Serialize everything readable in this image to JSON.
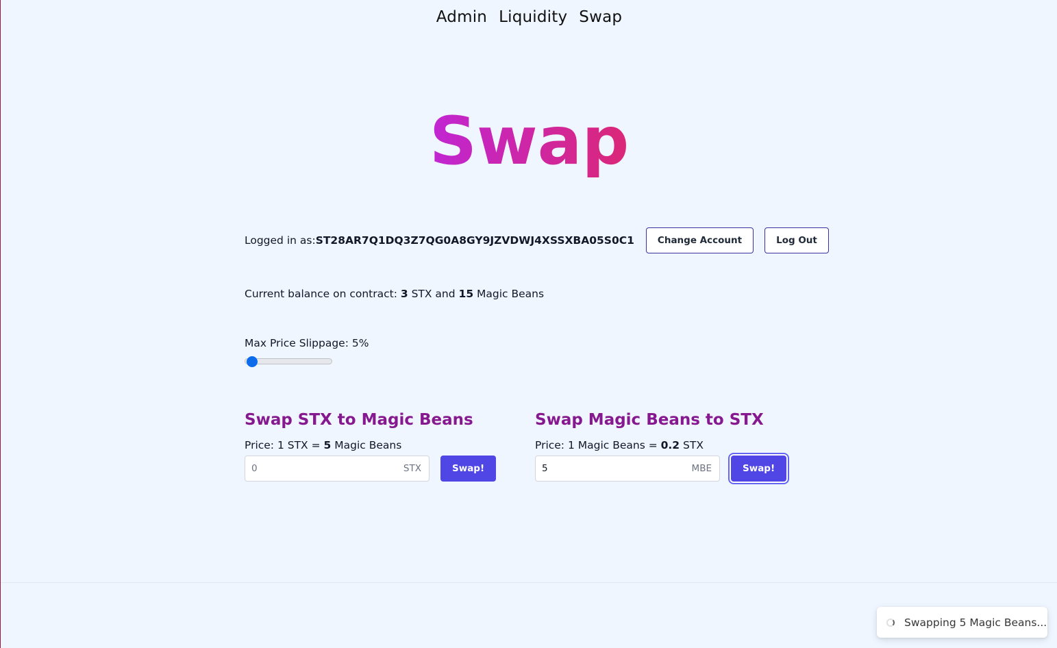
{
  "nav": {
    "items": [
      {
        "label": "Admin"
      },
      {
        "label": "Liquidity"
      },
      {
        "label": "Swap"
      }
    ]
  },
  "hero": {
    "title": "Swap"
  },
  "account": {
    "logged_in_label": "Logged in as: ",
    "address": "ST28AR7Q1DQ3Z7QG0A8GY9JZVDWJ4XSSXBA05S0C1",
    "change_button": "Change Account",
    "logout_button": "Log Out"
  },
  "balance": {
    "prefix": "Current balance on contract: ",
    "stx": "3",
    "mid": " STX and ",
    "beans": "15",
    "suffix": " Magic Beans"
  },
  "slippage": {
    "label": "Max Price Slippage: 5%",
    "value_percent": 5,
    "min": 0,
    "max": 100
  },
  "swap_stx": {
    "heading": "Swap STX to Magic Beans",
    "price_prefix": "Price: 1 STX = ",
    "price_value": "5",
    "price_suffix": " Magic Beans",
    "input_placeholder": "0",
    "unit": "STX",
    "button": "Swap!"
  },
  "swap_mbe": {
    "heading": "Swap Magic Beans to STX",
    "price_prefix": "Price: 1 Magic Beans = ",
    "price_value": "0.2",
    "price_suffix": " STX",
    "input_value": "5",
    "unit": "MBE",
    "button": "Swap!"
  },
  "toast": {
    "message": "Swapping 5 Magic Beans..."
  },
  "colors": {
    "background": "#eff6ff",
    "heading_purple": "#86198f",
    "primary_button": "#4f46e5",
    "title_gradient_start": "#c026d3",
    "title_gradient_end": "#db2777"
  }
}
